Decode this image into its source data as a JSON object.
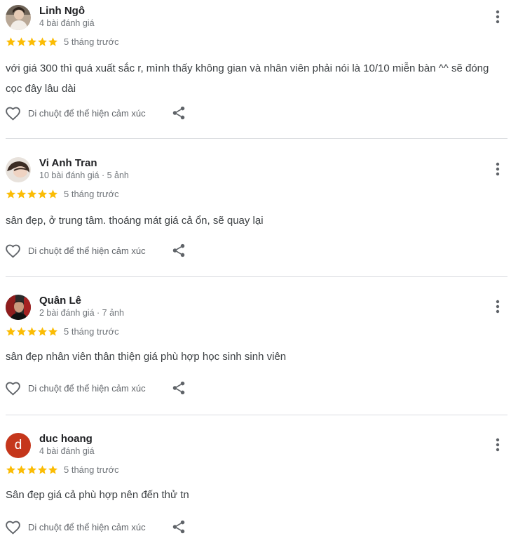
{
  "colors": {
    "star": "#fbbc04",
    "avatar_letter_bg": "#c5361b",
    "text_primary": "#202124",
    "text_secondary": "#70757a",
    "divider": "#dadce0"
  },
  "reviews": [
    {
      "name": "Linh Ngô",
      "meta": "4 bài đánh giá",
      "rating": 5,
      "time": "5 tháng trước",
      "text": "với giá 300 thì quá xuất sắc r, mình thấy không gian và nhân viên phải nói là 10/10 miễn bàn ^^ sẽ đóng cọc đây lâu dài",
      "like_label": "Di chuột để thể hiện cảm xúc",
      "avatar": "photo"
    },
    {
      "name": "Vi Anh Tran",
      "meta": "10 bài đánh giá · 5 ảnh",
      "rating": 5,
      "time": "5 tháng trước",
      "text": "sân đẹp, ở trung tâm. thoáng mát giá cả ổn, sẽ quay lại",
      "like_label": "Di chuột để thể hiện cảm xúc",
      "avatar": "photo"
    },
    {
      "name": "Quân Lê",
      "meta": "2 bài đánh giá · 7 ảnh",
      "rating": 5,
      "time": "5 tháng trước",
      "text": "sân đẹp nhân viên thân thiện giá phù hợp học sinh sinh viên",
      "like_label": "Di chuột để thể hiện cảm xúc",
      "avatar": "photo"
    },
    {
      "name": "duc hoang",
      "meta": "4 bài đánh giá",
      "rating": 5,
      "time": "5 tháng trước",
      "text": "Sân đẹp giá cả phù hợp nên đến thử tn",
      "like_label": "Di chuột để thể hiện cảm xúc",
      "avatar": "letter",
      "avatar_letter": "d"
    }
  ],
  "icons": {
    "more": "more-vert-icon",
    "like": "heart-outline-icon",
    "share": "share-icon",
    "star": "star-icon"
  }
}
